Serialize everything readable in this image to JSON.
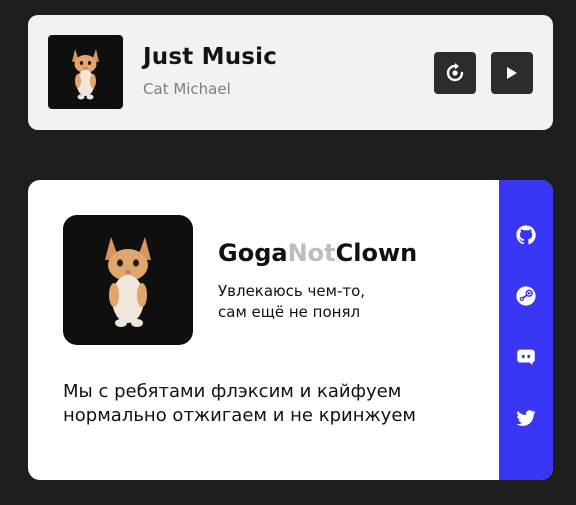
{
  "player": {
    "title": "Just Music",
    "artist": "Cat Michael",
    "cover_icon": "cat-image",
    "buttons": {
      "repeat_icon": "repeat-icon",
      "play_icon": "play-icon"
    }
  },
  "profile": {
    "name_part1": "Goga",
    "name_part2": "Not",
    "name_part3": "Clown",
    "status_line1": "Увлекаюсь чем-то,",
    "status_line2": "сам ещё не понял",
    "about_line1": "Мы с ребятами флэксим и кайфуем",
    "about_line2": "нормально отжигаем и не кринжуем",
    "social_icons": [
      "github-icon",
      "steam-icon",
      "discord-icon",
      "twitter-icon"
    ]
  },
  "colors": {
    "background": "#1e1e1e",
    "card": "#f2f2f2",
    "social_bar": "#3a36f5",
    "button": "#2c2c2c",
    "name_accent": "#bdbdbd"
  }
}
